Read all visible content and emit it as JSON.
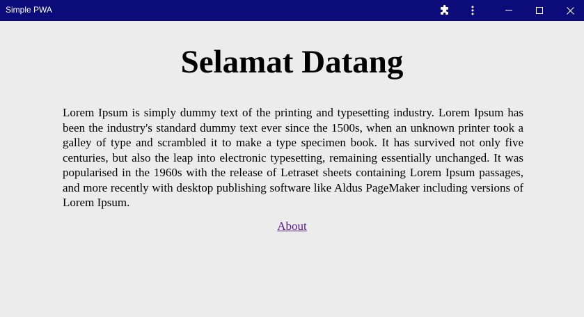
{
  "window": {
    "title": "Simple PWA",
    "titlebar_color": "#0b0b7a",
    "icons": [
      "puzzle-extensions-icon",
      "more-options-icon",
      "minimize-icon",
      "maximize-icon",
      "close-icon"
    ]
  },
  "page": {
    "background": "#ececec",
    "heading": "Selamat Datang",
    "paragraph": "Lorem Ipsum is simply dummy text of the printing and typesetting industry. Lorem Ipsum has been the industry's standard dummy text ever since the 1500s, when an unknown printer took a galley of type and scrambled it to make a type specimen book. It has survived not only five centuries, but also the leap into electronic typesetting, remaining essentially unchanged. It was popularised in the 1960s with the release of Letraset sheets containing Lorem Ipsum passages, and more recently with desktop publishing software like Aldus PageMaker including versions of Lorem Ipsum.",
    "link_label": "About",
    "link_color": "#551a8b"
  }
}
